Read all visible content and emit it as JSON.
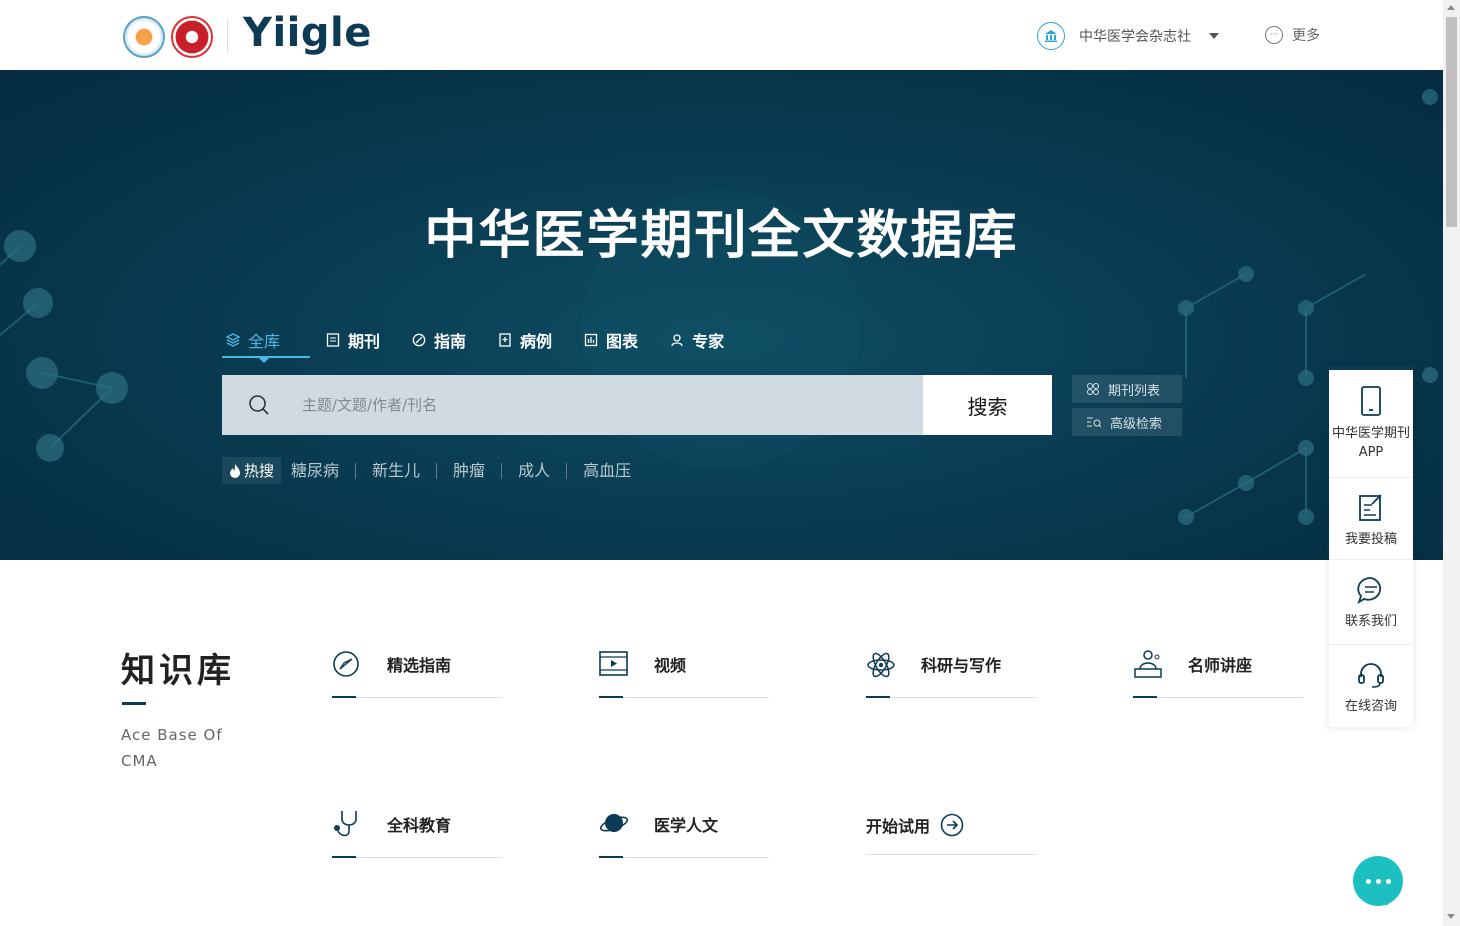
{
  "header": {
    "logo_text": "Yiigle",
    "institution": "中华医学会杂志社",
    "more": "更多"
  },
  "hero": {
    "title": "中华医学期刊全文数据库",
    "tabs": [
      "全库",
      "期刊",
      "指南",
      "病例",
      "图表",
      "专家"
    ],
    "active_tab": "全库",
    "search": {
      "placeholder": "主题/文题/作者/刊名",
      "value": "",
      "button": "搜索"
    },
    "side_links": [
      "期刊列表",
      "高级检索"
    ],
    "hot": {
      "label": "热搜",
      "items": [
        "糖尿病",
        "新生儿",
        "肿瘤",
        "成人",
        "高血压"
      ]
    }
  },
  "knowledge": {
    "title": "知识库",
    "subtitle_line1": "Ace Base Of",
    "subtitle_line2": "CMA",
    "categories": [
      "精选指南",
      "视频",
      "科研与写作",
      "名师讲座",
      "全科教育",
      "医学人文"
    ],
    "trial": "开始试用"
  },
  "float_panel": {
    "items": [
      "中华医学期刊APP",
      "我要投稿",
      "联系我们",
      "在线咨询"
    ]
  },
  "colors": {
    "brand": "#0d3b55",
    "accent": "#4fb7e6",
    "chat": "#1dc0c0"
  },
  "icons": {
    "search": "magnifier",
    "institution": "bank-building",
    "more": "ellipsis-circle",
    "chat": "chat-bubble"
  }
}
